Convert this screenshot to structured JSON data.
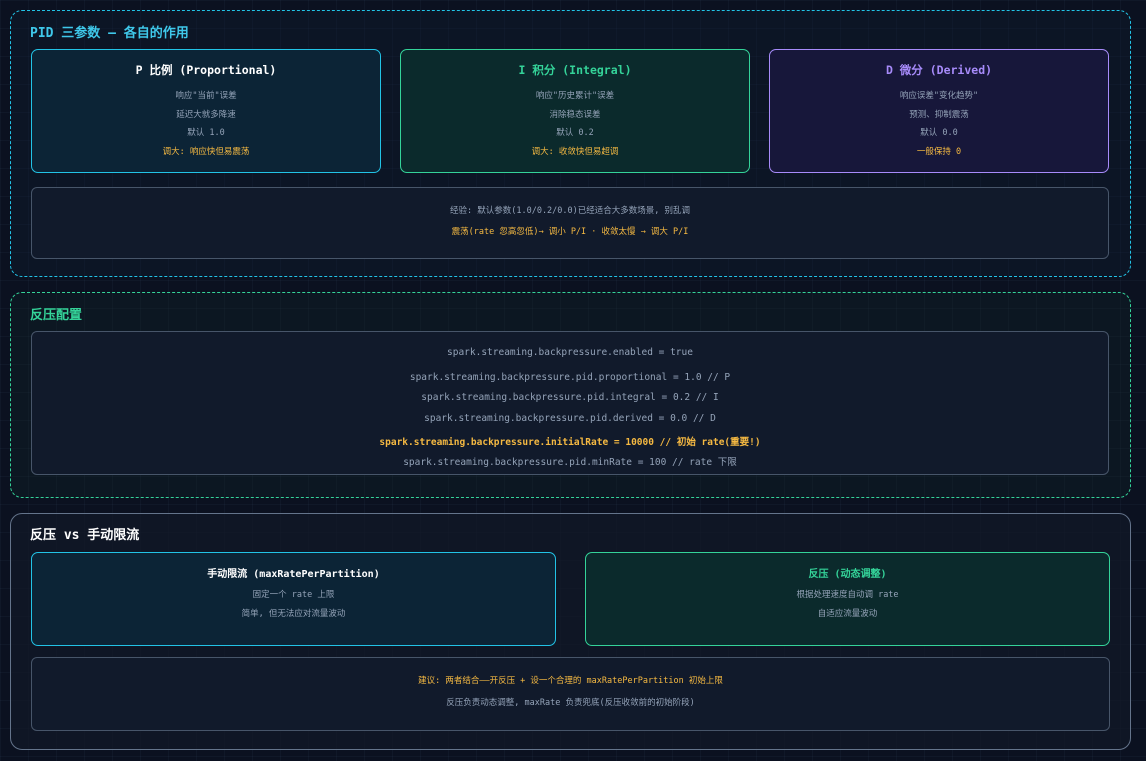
{
  "pid": {
    "title": "PID 三参数 — 各自的作用",
    "cards": [
      {
        "title": "P 比例 (Proportional)",
        "lines": [
          "响应\"当前\"误差",
          "延迟大就多降速",
          "默认 1.0"
        ],
        "tip": "调大: 响应快但易震荡"
      },
      {
        "title": "I 积分 (Integral)",
        "lines": [
          "响应\"历史累计\"误差",
          "消除稳态误差",
          "默认 0.2"
        ],
        "tip": "调大: 收敛快但易超调"
      },
      {
        "title": "D 微分 (Derived)",
        "lines": [
          "响应误差\"变化趋势\"",
          "预测、抑制震荡",
          "默认 0.0"
        ],
        "tip": "一般保持 0"
      }
    ],
    "note": {
      "line1": "经验: 默认参数(1.0/0.2/0.0)已经适合大多数场景, 别乱调",
      "line2": "震荡(rate 忽高忽低)→ 调小 P/I · 收敛太慢 → 调大 P/I"
    }
  },
  "backpressure": {
    "title": "反压配置",
    "lines": [
      "spark.streaming.backpressure.enabled = true",
      "spark.streaming.backpressure.pid.proportional = 1.0 // P",
      "spark.streaming.backpressure.pid.integral = 0.2 // I",
      "spark.streaming.backpressure.pid.derived = 0.0 // D",
      "spark.streaming.backpressure.initialRate = 10000 // 初始 rate(重要!)",
      "spark.streaming.backpressure.pid.minRate = 100 // rate 下限"
    ]
  },
  "compare": {
    "title": "反压 vs 手动限流",
    "cards": [
      {
        "title": "手动限流 (maxRatePerPartition)",
        "lines": [
          "固定一个 rate 上限",
          "简单, 但无法应对流量波动"
        ]
      },
      {
        "title": "反压 (动态调整)",
        "lines": [
          "根据处理速度自动调 rate",
          "自适应流量波动"
        ]
      }
    ],
    "note": {
      "line1": "建议: 两者结合——开反压 + 设一个合理的 maxRatePerPartition 初始上限",
      "line2": "反压负责动态调整, maxRate 负责兜底(反压收敛前的初始阶段)"
    }
  },
  "colors": {
    "blue": "#22c3e6",
    "green": "#34d399",
    "purple": "#a78bfa",
    "amber": "#f5b942"
  }
}
